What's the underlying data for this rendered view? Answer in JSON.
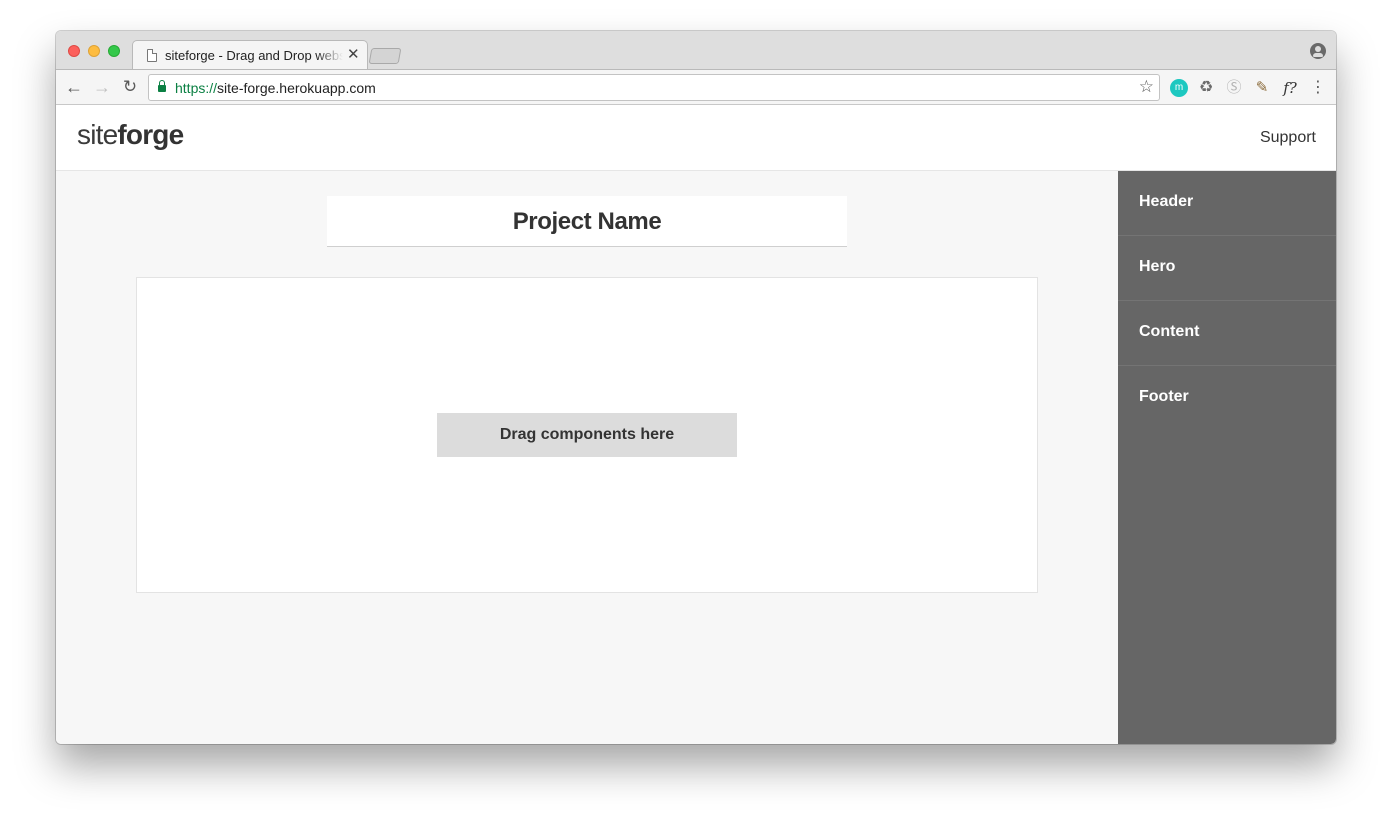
{
  "browser": {
    "tab_title": "siteforge - Drag and Drop website builder",
    "tab_close": "✕",
    "url_scheme": "https://",
    "url_rest": "site-forge.herokuapp.com",
    "ext_m_label": "m",
    "fn_label": "f?"
  },
  "app": {
    "logo_light": "site",
    "logo_bold": "forge",
    "support_label": "Support"
  },
  "project": {
    "name": "Project Name"
  },
  "canvas": {
    "dropzone_label": "Drag components here"
  },
  "sidebar": {
    "items": [
      {
        "label": "Header"
      },
      {
        "label": "Hero"
      },
      {
        "label": "Content"
      },
      {
        "label": "Footer"
      }
    ]
  }
}
